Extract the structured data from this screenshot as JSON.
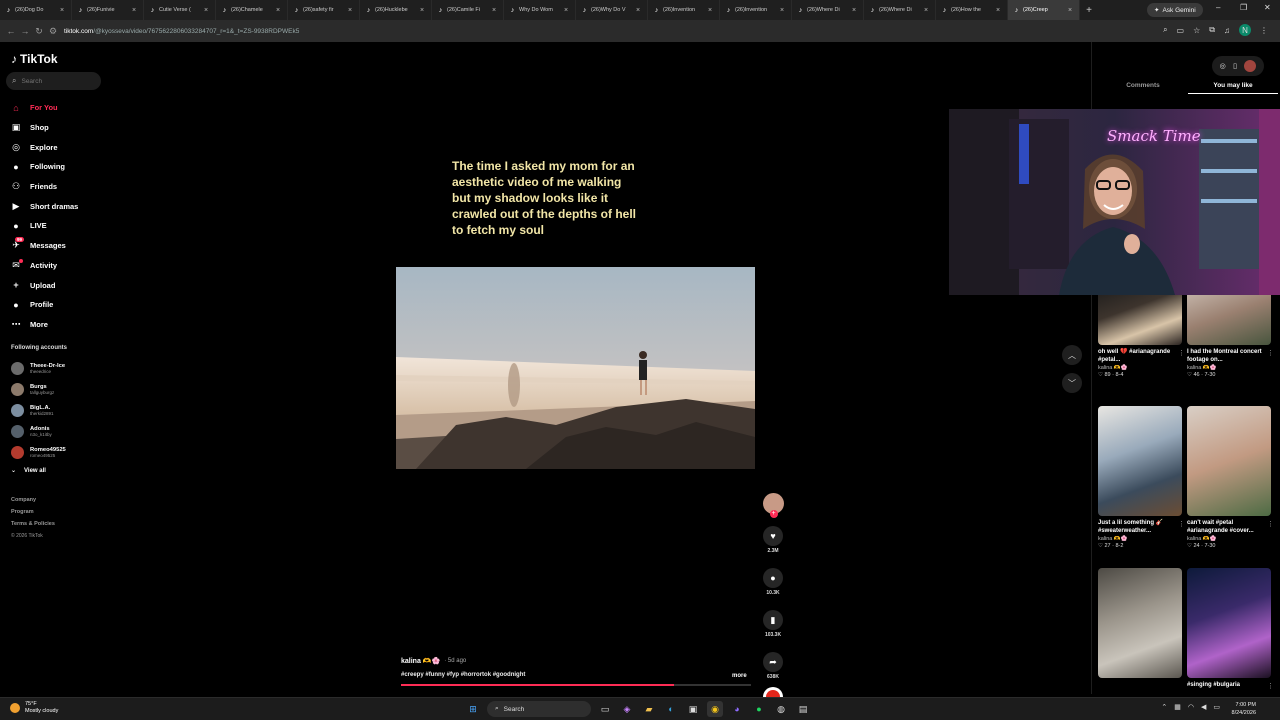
{
  "browser": {
    "tabs": [
      {
        "title": "(26)Dog Do",
        "icon": "tiktok-icon"
      },
      {
        "title": "(26)Funivie",
        "icon": "tiktok-icon"
      },
      {
        "title": "Cutie Verse (",
        "icon": "tiktok-icon"
      },
      {
        "title": "(26)Chamele",
        "icon": "tiktok-icon"
      },
      {
        "title": "(26)safety fir",
        "icon": "tiktok-icon"
      },
      {
        "title": "(26)Hucklebe",
        "icon": "tiktok-icon"
      },
      {
        "title": "(26)Camile Fi",
        "icon": "tiktok-icon"
      },
      {
        "title": "Why Do Wom",
        "icon": "tiktok-icon"
      },
      {
        "title": "(26)Why Do V",
        "icon": "tiktok-icon"
      },
      {
        "title": "(26)Invention",
        "icon": "tiktok-icon"
      },
      {
        "title": "(26)Invention",
        "icon": "tiktok-icon"
      },
      {
        "title": "(26)Where Di",
        "icon": "tiktok-icon"
      },
      {
        "title": "(26)Where Di",
        "icon": "tiktok-icon"
      },
      {
        "title": "(26)How the",
        "icon": "tiktok-icon"
      },
      {
        "title": "(26)Creep",
        "icon": "tiktok-icon",
        "active": true
      }
    ],
    "new_tab": "+",
    "gemini_label": "Ask Gemini",
    "url_host": "tiktok.com",
    "url_path": "/@kyosseva/video/7675622806033284707_r=1&_t=ZS-9938RDPWEk5",
    "window_controls": [
      "–",
      "❐",
      "✕"
    ]
  },
  "tiktok": {
    "logo": "TikTok",
    "search_placeholder": "Search",
    "menu": [
      {
        "label": "For You",
        "icon": "home-icon",
        "glyph": "⌂",
        "active": true
      },
      {
        "label": "Shop",
        "icon": "shop-icon",
        "glyph": "▣"
      },
      {
        "label": "Explore",
        "icon": "compass-icon",
        "glyph": "◎"
      },
      {
        "label": "Following",
        "icon": "following-icon",
        "glyph": "●"
      },
      {
        "label": "Friends",
        "icon": "friends-icon",
        "glyph": "⚇"
      },
      {
        "label": "Short dramas",
        "icon": "drama-icon",
        "glyph": "▶"
      },
      {
        "label": "LIVE",
        "icon": "live-icon",
        "glyph": "●"
      },
      {
        "label": "Messages",
        "icon": "messages-icon",
        "glyph": "✈",
        "badge": "99"
      },
      {
        "label": "Activity",
        "icon": "activity-icon",
        "glyph": "✉",
        "dot": true
      },
      {
        "label": "Upload",
        "icon": "upload-icon",
        "glyph": "+"
      },
      {
        "label": "Profile",
        "icon": "profile-icon",
        "glyph": "●"
      },
      {
        "label": "More",
        "icon": "more-icon",
        "glyph": "⋯"
      }
    ],
    "following_heading": "Following accounts",
    "following_accounts": [
      {
        "name": "Theee-Dr-Ice",
        "user": "theeedrice"
      },
      {
        "name": "Burgs",
        "user": "tallguyburgz"
      },
      {
        "name": "BigL.A.",
        "user": "therkid2891"
      },
      {
        "name": "Adonis",
        "user": "n3o_k1itby"
      },
      {
        "name": "Romeo49525",
        "user": "romeo49525"
      }
    ],
    "view_all": "View all",
    "footer": [
      "Company",
      "Program",
      "Terms & Policies"
    ],
    "copyright": "© 2026 TikTok"
  },
  "video": {
    "overlay_caption": "The time I asked my mom for an aesthetic video of me walking but my shadow looks like it crawled out of the depths of hell to fetch my soul",
    "author": "kalina 🫶🌸",
    "posted": "· 5d ago",
    "hashtags": "#creepy #funny #fyp #horrortok #goodnight",
    "more": "more",
    "progress": 0.78,
    "likes": "2.3M",
    "comments": "10.3K",
    "saves": "103.3K",
    "shares": "638K"
  },
  "right_panel": {
    "tabs": [
      {
        "label": "Comments",
        "active": false
      },
      {
        "label": "You may like",
        "active": true
      }
    ],
    "cards": [
      {
        "title": "oh well 💔 #arianagrande #petal...",
        "author": "kalina 🫶🌸",
        "stats": "♡ 89 · 8-4"
      },
      {
        "title": "I had the Montreal concert footage on...",
        "author": "kalina 🫶🌸",
        "stats": "♡ 46 · 7-30"
      },
      {
        "title": "Just a lil something 🎸 #sweaterweather...",
        "author": "kalina 🫶🌸",
        "stats": "♡ 27 · 8-2"
      },
      {
        "title": "can't wait #petal #arianagrande #cover...",
        "author": "kalina 🫶🌸",
        "stats": "♡ 24 · 7-30"
      },
      {
        "title": "",
        "author": "",
        "stats": ""
      },
      {
        "title": "#singing #bulgaria",
        "author": "",
        "stats": ""
      }
    ],
    "webcam_sign": "Smack Time"
  },
  "taskbar": {
    "temp": "75°F",
    "condition": "Mostly cloudy",
    "search_label": "Search",
    "time": "7:00 PM",
    "date": "8/24/2026"
  }
}
